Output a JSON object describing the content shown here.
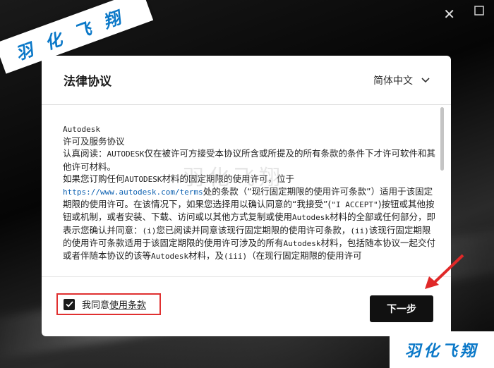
{
  "window": {
    "close_glyph": "✕"
  },
  "watermark": {
    "top_left": "羽化飞翔",
    "bottom_right": "羽化飞翔",
    "faint": "羽化飞翔"
  },
  "dialog": {
    "title": "法律协议",
    "language": {
      "selected": "简体中文",
      "icon": "chevron-down-icon"
    },
    "agreement": {
      "heading": "Autodesk",
      "subheading": "许可及服务协议",
      "p1_a": "认真阅读：",
      "p1_brand": "AUTODESK",
      "p1_b": "仅在被许可方接受本协议所含或所提及的所有条款的条件下才许可软件和其他许可材料。",
      "p2_a": "如果您订购任何",
      "p2_brand": "AUTODESK",
      "p2_b": "材料的固定期限的使用许可，位于",
      "p2_link": "https://www.autodesk.com/terms",
      "p2_c": "处的条款（“现行固定期限的使用许可条款”）适用于该固定期限的使用许可。在该情况下，如果您选择用以确认同意的“我接受”(",
      "p2_accept": "\"I ACCEPT\"",
      "p2_d": ")按钮或其他按钮或机制，或者安装、下载、访问或以其他方式复制或使用",
      "p2_brand2": "Autodesk",
      "p2_e": "材料的全部或任何部分，即表示您确认并同意：",
      "p2_i": "(i)",
      "p2_f": "您已阅读并同意该现行固定期限的使用许可条款，",
      "p2_ii": "(ii)",
      "p2_g": "该现行固定期限的使用许可条款适用于该固定期限的使用许可涉及的所有",
      "p2_brand3": "Autodesk",
      "p2_h": "材料，包括随本协议一起交付或者伴随本协议的该等",
      "p2_brand4": "Autodesk",
      "p2_j": "材料，及",
      "p2_iii": "(iii)",
      "p2_k": "（在现行固定期限的使用许可"
    },
    "agree": {
      "prefix": "我同意",
      "link": "使用条款",
      "checked": true
    },
    "next_button": "下一步"
  },
  "colors": {
    "accent": "#111111",
    "highlight": "#e03030",
    "watermark": "#0a78c8",
    "link": "#0a5fb0"
  }
}
